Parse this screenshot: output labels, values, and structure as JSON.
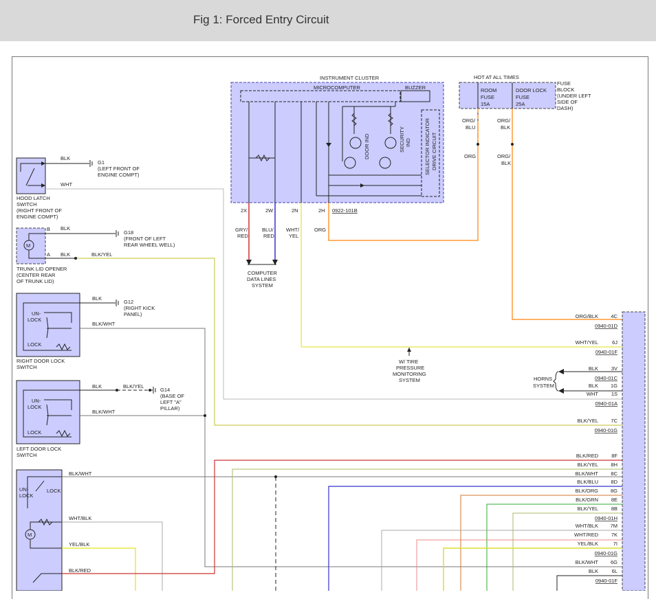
{
  "header": {
    "title": "Fig 1: Forced Entry Circuit"
  },
  "cluster": {
    "title": "INSTRUMENT CLUSTER",
    "microcomputer": "MICROCOMPUTER",
    "buzzer": "BUZZER",
    "door_ind": "DOOR IND",
    "security_ind_1": "SECURITY",
    "security_ind_2": "IND",
    "selector_1": "SELECTOR INDICATOR",
    "selector_2": "DRIVE CIRCUIT",
    "pins": [
      "2X",
      "2W",
      "2N",
      "2H"
    ],
    "connector": "0922-101B"
  },
  "fuse_block": {
    "hot": "HOT AT ALL TIMES",
    "room_fuse": [
      "ROOM",
      "FUSE",
      "15A"
    ],
    "door_lock_fuse": [
      "DOOR LOCK",
      "FUSE",
      "25A"
    ],
    "label": [
      "FUSE",
      "BLOCK",
      "(UNDER LEFT",
      "SIDE OF",
      "DASH)"
    ]
  },
  "wires": {
    "org_blu": [
      "ORG/",
      "BLU"
    ],
    "org_blk": [
      "ORG/",
      "BLK"
    ],
    "org": "ORG",
    "org_blk2": [
      "ORG/",
      "BLK"
    ],
    "gry_red": [
      "GRY/",
      "RED"
    ],
    "blu_red": [
      "BLU/",
      "RED"
    ],
    "wht_yel": [
      "WHT/",
      "YEL"
    ],
    "org3": "ORG"
  },
  "computer_data": [
    "COMPUTER",
    "DATA LINES",
    "SYSTEM"
  ],
  "tire_pressure": [
    "W/ TIRE",
    "PRESSURE",
    "MONITORING",
    "SYSTEM"
  ],
  "horns": [
    "HORNS",
    "SYSTEM"
  ],
  "hood": {
    "blk": "BLK",
    "wht": "WHT",
    "ground": "G1",
    "ground_desc": [
      "(LEFT FRONT OF",
      "ENGINE COMPT)"
    ],
    "label": [
      "HOOD LATCH",
      "SWITCH",
      "(RIGHT FRONT OF",
      "ENGINE COMPT)"
    ]
  },
  "trunk": {
    "pin_b": "B",
    "pin_a": "A",
    "blk1": "BLK",
    "blk2": "BLK",
    "blk_yel": "BLK/YEL",
    "ground": "G18",
    "ground_desc": [
      "(FRONT OF LEFT",
      "REAR WHEEL WELL)"
    ],
    "label": [
      "TRUNK LID OPENER",
      "(CENTER REAR",
      "OF TRUNK LID)"
    ]
  },
  "right_door": {
    "unlock": [
      "UN-",
      "LOCK"
    ],
    "lock": "LOCK",
    "blk": "BLK",
    "blk_wht": "BLK/WHT",
    "ground": "G12",
    "ground_desc": [
      "(RIGHT KICK",
      "PANEL)"
    ],
    "label": [
      "RIGHT DOOR LOCK",
      "SWITCH"
    ]
  },
  "left_door": {
    "unlock": [
      "UN-",
      "LOCK"
    ],
    "lock": "LOCK",
    "blk": "BLK",
    "blk_yel": "BLK/YEL",
    "blk_wht": "BLK/WHT",
    "ground": "G14",
    "ground_desc": [
      "(BASE OF",
      "LEFT \"A\"",
      "PILLAR)"
    ],
    "label": [
      "LEFT DOOR LOCK",
      "SWITCH"
    ]
  },
  "actuator": {
    "unlock": [
      "UN-",
      "LOCK"
    ],
    "lock": "LOCK",
    "w1": "BLK/WHT",
    "w2": "WHT/BLK",
    "w3": "YEL/BLK",
    "w4": "BLK/RED"
  },
  "module_rows": [
    {
      "wire": "ORG/BLK",
      "pin": "4C",
      "conn": "0940-01D"
    },
    {
      "wire": "WHT/YEL",
      "pin": "6J",
      "conn": "0940-01F"
    },
    {
      "wire": "BLK",
      "pin": "3V",
      "conn": "0940-01C"
    },
    {
      "wire": "BLK",
      "pin": "1G",
      "conn": ""
    },
    {
      "wire": "WHT",
      "pin": "1S",
      "conn": "0940-01A"
    },
    {
      "wire": "BLK/YEL",
      "pin": "7C",
      "conn": "0940-01G"
    },
    {
      "wire": "BLK/RED",
      "pin": "8F",
      "conn": ""
    },
    {
      "wire": "BLK/YEL",
      "pin": "8H",
      "conn": ""
    },
    {
      "wire": "BLK/WHT",
      "pin": "8C",
      "conn": ""
    },
    {
      "wire": "BLK/BLU",
      "pin": "8D",
      "conn": ""
    },
    {
      "wire": "BLK/ORG",
      "pin": "8G",
      "conn": ""
    },
    {
      "wire": "BLK/GRN",
      "pin": "8E",
      "conn": ""
    },
    {
      "wire": "BLK/YEL",
      "pin": "8B",
      "conn": "0940-01H"
    },
    {
      "wire": "WHT/BLK",
      "pin": "7M",
      "conn": ""
    },
    {
      "wire": "WHT/RED",
      "pin": "7K",
      "conn": ""
    },
    {
      "wire": "YEL/BLK",
      "pin": "7I",
      "conn": "0940-01G"
    },
    {
      "wire": "BLK/WHT",
      "pin": "6G",
      "conn": "0940-01F"
    },
    {
      "wire": "BLK",
      "pin": "6L",
      "conn": "0940-01F"
    }
  ],
  "colors": {
    "fill": "#ccccff",
    "org": "#ff9933",
    "red": "#cc3333",
    "blue": "#3333cc",
    "yellow": "#e8e860",
    "gray": "#888888"
  }
}
